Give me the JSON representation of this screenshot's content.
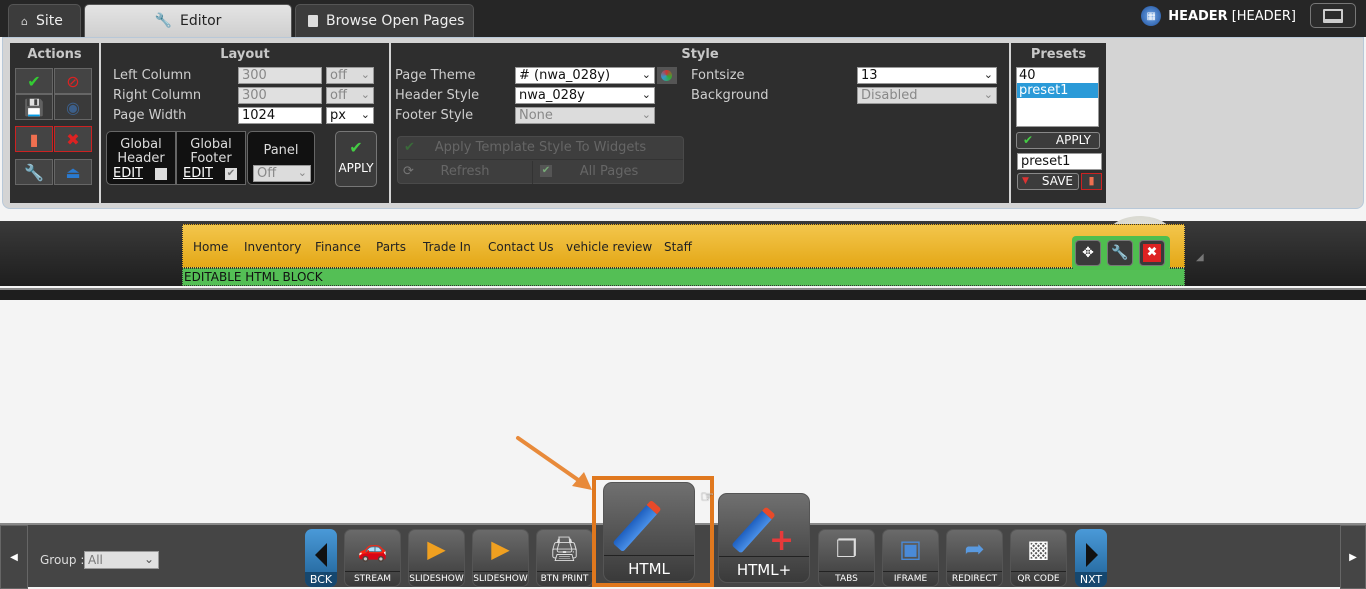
{
  "tabs": [
    {
      "label": "Site",
      "icon": "home-icon"
    },
    {
      "label": "Editor",
      "icon": "wrench-icon",
      "active": true
    },
    {
      "label": "Browse Open Pages",
      "icon": "page-icon"
    }
  ],
  "header_label": {
    "title": "HEADER",
    "subtitle": "[HEADER]"
  },
  "actions": {
    "title": "Actions"
  },
  "layout": {
    "title": "Layout",
    "left_column": {
      "label": "Left Column",
      "value": "300",
      "unit": "off"
    },
    "right_column": {
      "label": "Right Column",
      "value": "300",
      "unit": "off"
    },
    "page_width": {
      "label": "Page Width",
      "value": "1024",
      "unit": "px"
    },
    "global_header": {
      "line1": "Global",
      "line2": "Header",
      "edit": "EDIT",
      "checked": false
    },
    "global_footer": {
      "line1": "Global",
      "line2": "Footer",
      "edit": "EDIT",
      "checked": true
    },
    "panel": {
      "label": "Panel",
      "value": "Off"
    },
    "apply": "APPLY"
  },
  "style": {
    "title": "Style",
    "page_theme": {
      "label": "Page Theme",
      "value": "# (nwa_028y)"
    },
    "header_style": {
      "label": "Header Style",
      "value": "nwa_028y"
    },
    "footer_style": {
      "label": "Footer Style",
      "value": "None"
    },
    "fontsize": {
      "label": "Fontsize",
      "value": "13"
    },
    "background": {
      "label": "Background",
      "value": "Disabled"
    },
    "apply_template": "Apply Template Style To Widgets",
    "refresh": "Refresh",
    "all_pages": "All Pages"
  },
  "presets": {
    "title": "Presets",
    "items": [
      "40",
      "preset1"
    ],
    "selected": "preset1",
    "apply": "APPLY",
    "name_value": "preset1",
    "save": "SAVE"
  },
  "nav_menu": [
    "Home",
    "Inventory",
    "Finance",
    "Parts",
    "Trade In",
    "Contact Us",
    "vehicle review",
    "Staff"
  ],
  "editable_block": "EDITABLE HTML BLOCK",
  "bottom": {
    "group_label": "Group :",
    "group_value": "All",
    "back": "BCK",
    "next": "NXT",
    "widgets": [
      "STREAM",
      "SLIDESHOW",
      "SLIDESHOW",
      "BTN PRINT",
      "HTML",
      "HTML+",
      "TABS",
      "IFRAME",
      "REDIRECT",
      "QR CODE"
    ]
  },
  "colors": {
    "highlight": "#e0781e",
    "accent_blue": "#1e90d8",
    "nav_yellow": "#f0bd3c",
    "block_green": "#54bf55"
  }
}
